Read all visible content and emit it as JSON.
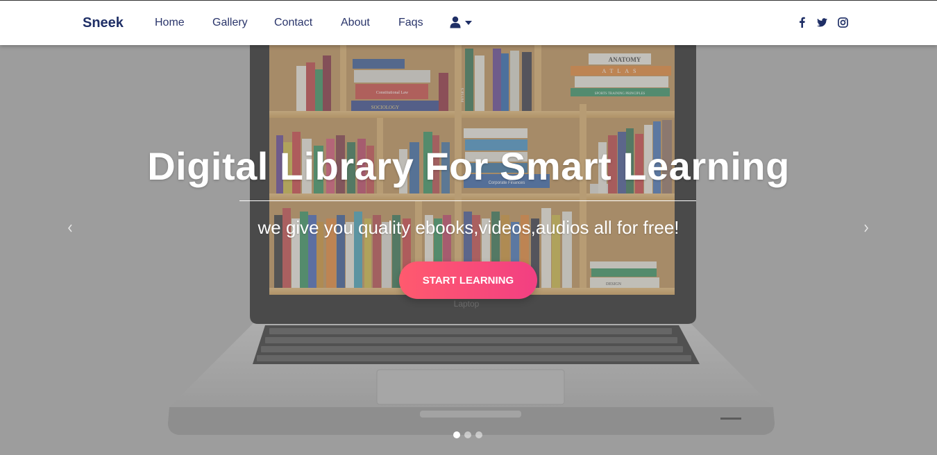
{
  "navbar": {
    "brand": "Sneek",
    "links": [
      "Home",
      "Gallery",
      "Contact",
      "About",
      "Faqs"
    ],
    "user_icon": "user-icon",
    "social_icons": [
      "facebook-icon",
      "twitter-icon",
      "instagram-icon"
    ]
  },
  "hero": {
    "title": "Digital Library For Smart Learning",
    "subtitle": "we give you quality ebooks,videos,audios all for free!",
    "cta_label": "START LEARNING",
    "laptop_brand": "Laptop",
    "book_labels": [
      "ANATOMY",
      "ATLAS",
      "SOCIOLOGY",
      "PHYSICS",
      "Corporate Finances",
      "DESIGN",
      "SPORTS TRAINING PRINCIPLES",
      "Constitutional Law"
    ],
    "slides_total": 3,
    "active_slide": 1
  },
  "colors": {
    "brand": "#1f2f66",
    "cta_start": "#ff5a6e",
    "cta_end": "#f23f82",
    "overlay": "#aaaaaa"
  }
}
